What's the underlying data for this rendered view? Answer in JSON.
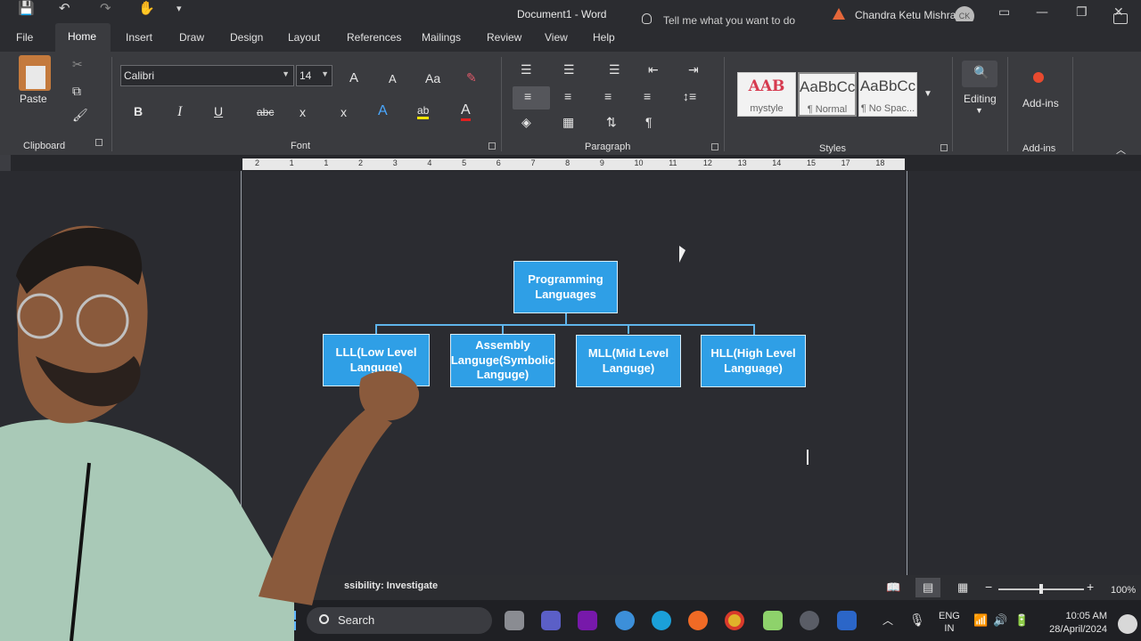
{
  "titlebar": {
    "doc_title": "Document1 - Word",
    "user_name": "Chandra Ketu Mishra",
    "user_initials": "CK",
    "quick_access": {
      "save": "💾",
      "undo": "↶",
      "redo": "↷",
      "customize": "▾"
    }
  },
  "tabs": [
    "File",
    "Home",
    "Insert",
    "Draw",
    "Design",
    "Layout",
    "References",
    "Mailings",
    "Review",
    "View",
    "Help"
  ],
  "tell_me": "Tell me what you want to do",
  "ribbon": {
    "clipboard": {
      "paste": "Paste",
      "label": "Clipboard"
    },
    "font": {
      "font_name": "Calibri",
      "font_size": "14",
      "label": "Font",
      "grow": "A",
      "shrink": "A",
      "change_case": "Aa",
      "bold": "B",
      "italic": "I",
      "underline": "U",
      "strike": "abc",
      "subscript": "x",
      "superscript": "x",
      "text_effects": "A",
      "highlight": "ab",
      "font_color": "A"
    },
    "paragraph": {
      "label": "Paragraph",
      "pilcrow": "¶"
    },
    "styles": {
      "label": "Styles",
      "items": [
        {
          "preview": "AAB",
          "name": "mystyle"
        },
        {
          "preview": "AaBbCc",
          "name": "¶ Normal"
        },
        {
          "preview": "AaBbCc",
          "name": "¶ No Spac..."
        }
      ]
    },
    "editing": {
      "label": "Editing"
    },
    "addins": {
      "button": "Add-ins",
      "label": "Add-ins"
    }
  },
  "ruler": [
    "2",
    "1",
    "1",
    "2",
    "3",
    "4",
    "5",
    "6",
    "7",
    "8",
    "9",
    "10",
    "11",
    "12",
    "13",
    "14",
    "15",
    "17",
    "18"
  ],
  "diagram": {
    "root": "Programming Languages",
    "children": [
      "LLL(Low Level Languge)",
      "Assembly Languge(Symbolic Languge)",
      "MLL(Mid Level Languge)",
      "HLL(High Level Language)"
    ],
    "node_color": "#2f9fe6"
  },
  "statusbar": {
    "accessibility": "ssibility: Investigate",
    "zoom": "100%"
  },
  "taskbar": {
    "search": "Search",
    "lang_line1": "ENG",
    "lang_line2": "IN",
    "time": "10:05 AM",
    "date": "28/April/2024"
  }
}
